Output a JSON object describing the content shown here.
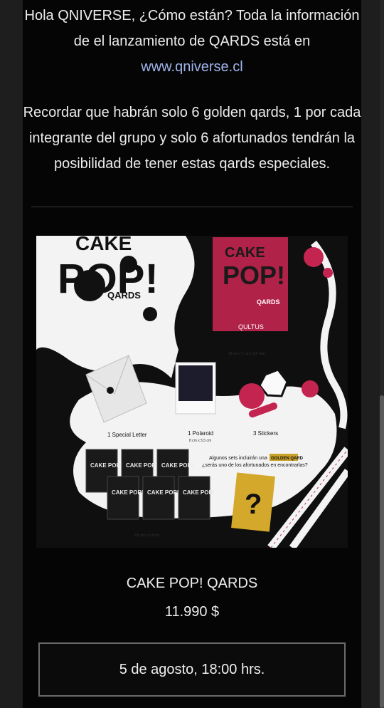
{
  "email": {
    "intro_before_link": "Hola QNIVERSE, ¿Cómo están? Toda la información de el lanzamiento de QARDS está en ",
    "intro_link": "www.qniverse.cl",
    "paragraph2": "Recordar que habrán solo 6 golden qards, 1 por cada integrante del grupo y solo 6 afortunados tendrán la posibilidad de tener estas qards especiales.",
    "product_name": "CAKE POP! QARDS",
    "price": "11.990 $",
    "date_button": "5 de agosto, 18:00 hrs."
  },
  "promo": {
    "logo_cake": "CAKE",
    "logo_pop": "POP!",
    "logo_qards": "QARDS",
    "book_cake": "CAKE",
    "book_pop": "POP!",
    "book_qards": "QARDS",
    "book_brand": "QULTUS",
    "guestbook_label": "Guestbook",
    "guestbook_size": "18 cm x 7 cm x 0,5 mm",
    "letter_label": "1 Special Letter",
    "polaroid_label": "1 Polaroid",
    "polaroid_size": "8 cm x 5,5 cm",
    "stickers_label": "3 Stickers",
    "golden_text_1": "Algunos sets incluirán una",
    "golden_badge": "GOLDEN QARD",
    "golden_text_2": "¿serás uno de los afortunados en encontrarlas?",
    "photocards_label": "2 Photocards al azar",
    "photocards_size": "8,8 cm x 5,5 cm",
    "golden_mark": "?",
    "mini_card_text": "CAKE POP!",
    "colors": {
      "magenta": "#c42550",
      "gold": "#d4a82a",
      "paper": "#f3f3f3"
    }
  }
}
